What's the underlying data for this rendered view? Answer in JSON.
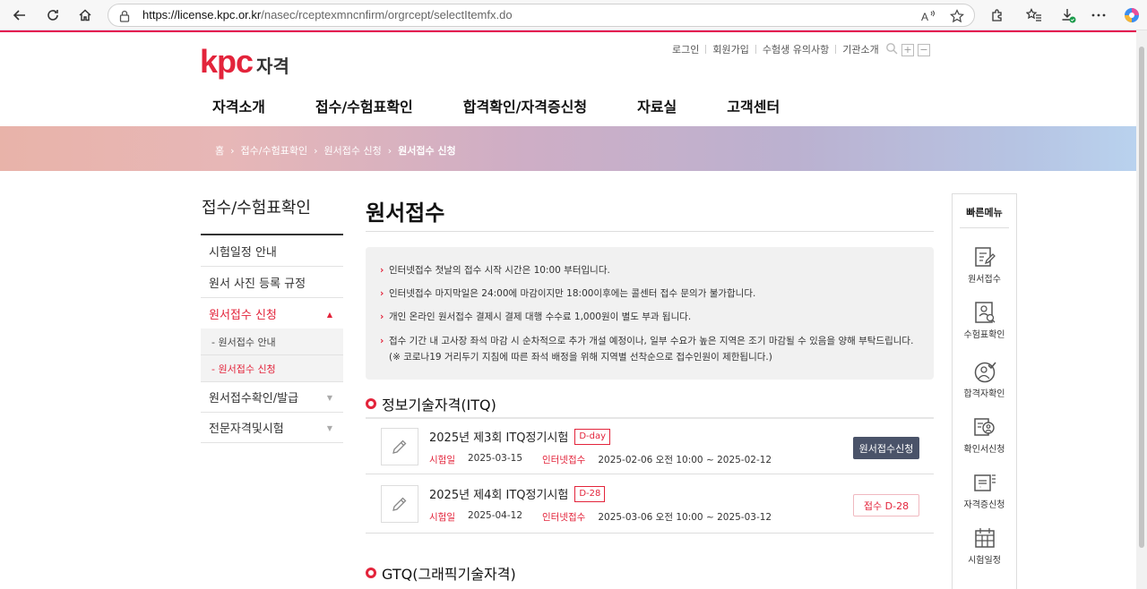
{
  "browser": {
    "url_host": "https://license.kpc.or.kr",
    "url_path": "/nasec/rceptexmncnfirm/orgrcept/selectItemfx.do"
  },
  "header": {
    "logo_text": "kpc",
    "logo_suffix": "자격",
    "util_links": [
      "로그인",
      "회원가입",
      "수험생 유의사항",
      "기관소개"
    ],
    "gnb": [
      "자격소개",
      "접수/수험표확인",
      "합격확인/자격증신청",
      "자료실",
      "고객센터"
    ]
  },
  "breadcrumb": [
    "홈",
    "접수/수험표확인",
    "원서접수 신청",
    "원서접수 신청"
  ],
  "sidebar": {
    "title": "접수/수험표확인",
    "items": [
      {
        "label": "시험일정 안내"
      },
      {
        "label": "원서 사진 등록 규정"
      },
      {
        "label": "원서접수 신청",
        "active": true
      },
      {
        "label": "원서접수확인/발급"
      },
      {
        "label": "전문자격및시험"
      }
    ],
    "subitems": [
      {
        "label": "- 원서접수 안내"
      },
      {
        "label": "- 원서접수 신청",
        "active": true
      }
    ]
  },
  "main": {
    "title": "원서접수",
    "notices": [
      "인터넷접수 첫날의 접수 시작 시간은 10:00 부터입니다.",
      "인터넷접수 마지막일은 24:00에 마감이지만 18:00이후에는 콜센터 접수 문의가 불가합니다.",
      "개인 온라인 원서접수 결제시 결제 대행 수수료 1,000원이 별도 부과 됩니다.",
      "접수 기간 내 고사장 좌석 마감 시 순차적으로 추가 개설 예정이나, 일부 수요가 높은 지역은 조기 마감될 수 있음을 양해 부탁드립니다.(※ 코로나19 거리두기 지침에 따른 좌석 배정을 위해 지역별 선착순으로 접수인원이 제한됩니다.)"
    ],
    "sections": [
      {
        "title": "정보기술자격(ITQ)",
        "exams": [
          {
            "name": "2025년 제3회 ITQ정기시험",
            "badge": "D-day",
            "exam_label": "시험일",
            "exam_date": "2025-03-15",
            "rcpt_label": "인터넷접수",
            "rcpt_period": "2025-02-06 오전 10:00 ~ 2025-02-12",
            "action": "원서접수신청"
          },
          {
            "name": "2025년 제4회 ITQ정기시험",
            "badge": "D-28",
            "exam_label": "시험일",
            "exam_date": "2025-04-12",
            "rcpt_label": "인터넷접수",
            "rcpt_period": "2025-03-06 오전 10:00 ~ 2025-03-12",
            "action": "접수 D-28"
          }
        ]
      },
      {
        "title": "GTQ(그래픽기술자격)"
      }
    ]
  },
  "quick_menu": {
    "title": "빠른메뉴",
    "items": [
      {
        "label": "원서접수",
        "icon": "form-edit-icon"
      },
      {
        "label": "수험표확인",
        "icon": "id-card-icon"
      },
      {
        "label": "합격자확인",
        "icon": "user-check-icon"
      },
      {
        "label": "확인서신청",
        "icon": "document-user-icon"
      },
      {
        "label": "자격증신청",
        "icon": "license-card-icon"
      },
      {
        "label": "시험일정",
        "icon": "calendar-icon"
      }
    ]
  },
  "colors": {
    "accent": "#e3243b",
    "button_dark": "#4a5369"
  }
}
